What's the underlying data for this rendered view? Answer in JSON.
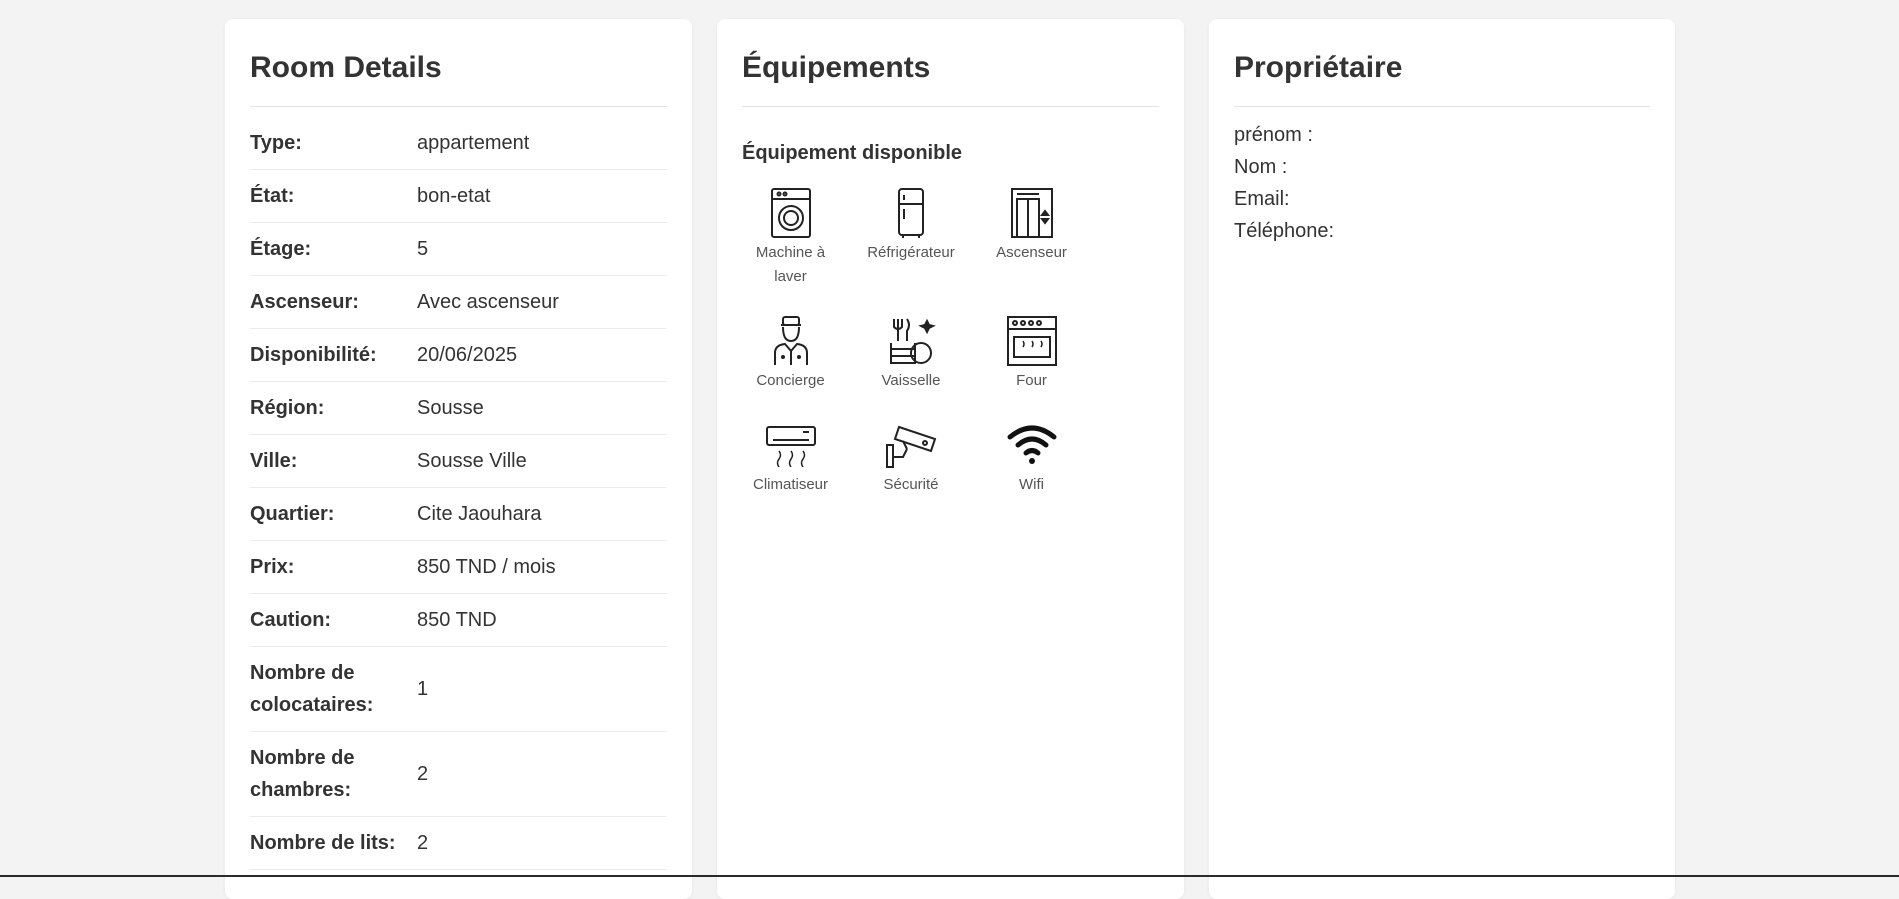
{
  "details": {
    "title": "Room Details",
    "rows": [
      {
        "label": "Type:",
        "value": "appartement"
      },
      {
        "label": "État:",
        "value": "bon-etat"
      },
      {
        "label": "Étage:",
        "value": "5"
      },
      {
        "label": "Ascenseur:",
        "value": "Avec ascenseur"
      },
      {
        "label": "Disponibilité:",
        "value": "20/06/2025"
      },
      {
        "label": "Région:",
        "value": "Sousse"
      },
      {
        "label": "Ville:",
        "value": "Sousse Ville"
      },
      {
        "label": "Quartier:",
        "value": "Cite Jaouhara"
      },
      {
        "label": "Prix:",
        "value": "850 TND / mois"
      },
      {
        "label": "Caution:",
        "value": "850 TND"
      },
      {
        "label": "Nombre de colocataires:",
        "value": "1"
      },
      {
        "label": "Nombre de chambres:",
        "value": "2"
      },
      {
        "label": "Nombre de lits:",
        "value": "2"
      }
    ]
  },
  "equipment": {
    "title": "Équipements",
    "subtitle": "Équipement disponible",
    "items": [
      {
        "label": "Machine à laver",
        "icon": "washing-machine-icon"
      },
      {
        "label": "Réfrigérateur",
        "icon": "refrigerator-icon"
      },
      {
        "label": "Ascenseur",
        "icon": "elevator-icon"
      },
      {
        "label": "Concierge",
        "icon": "concierge-icon"
      },
      {
        "label": "Vaisselle",
        "icon": "dishes-icon"
      },
      {
        "label": "Four",
        "icon": "oven-icon"
      },
      {
        "label": "Climatiseur",
        "icon": "air-conditioner-icon"
      },
      {
        "label": "Sécurité",
        "icon": "security-camera-icon"
      },
      {
        "label": "Wifi",
        "icon": "wifi-icon"
      }
    ]
  },
  "owner": {
    "title": "Propriétaire",
    "first_name": "prénom :",
    "last_name": "Nom :",
    "email": "Email:",
    "phone": "Téléphone:"
  }
}
